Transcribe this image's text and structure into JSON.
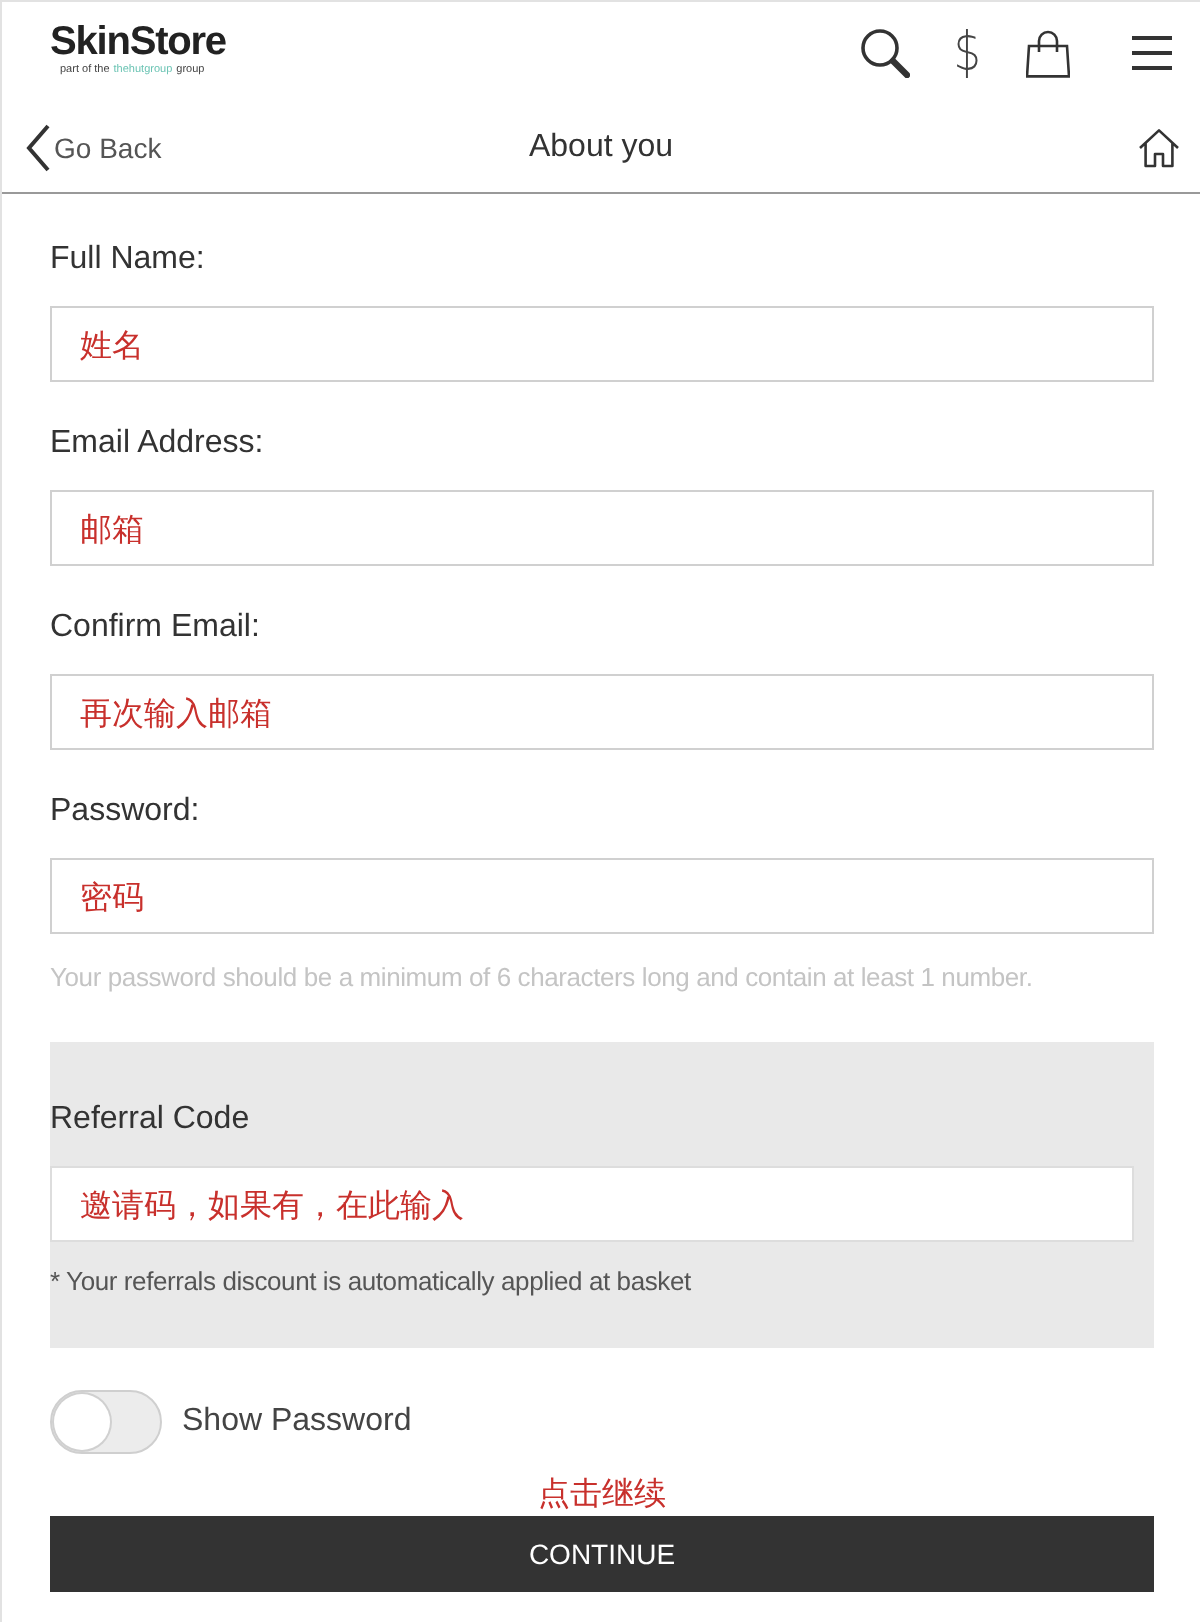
{
  "header": {
    "logo": {
      "name": "SkinStore",
      "tagline_prefix": "part of the",
      "tagline_brand": "thehutgroup",
      "tagline_suffix": "group"
    },
    "currency_symbol": "$"
  },
  "nav": {
    "back": "Go Back",
    "title": "About you"
  },
  "fields": [
    {
      "label": "Full Name:",
      "placeholder": "姓名"
    },
    {
      "label": "Email Address:",
      "placeholder": "邮箱"
    },
    {
      "label": "Confirm Email:",
      "placeholder": "再次输入邮箱"
    },
    {
      "label": "Password:",
      "placeholder": "密码"
    }
  ],
  "password_hint": "Your password should be a minimum of 6 characters long and contain at least 1 number.",
  "referral": {
    "label": "Referral Code",
    "placeholder": "邀请码，如果有，在此输入",
    "note": "* Your referrals discount is automatically applied at basket"
  },
  "show_password": {
    "label": "Show Password",
    "on": false
  },
  "annotation": "点击继续",
  "continue_button": "CONTINUE"
}
